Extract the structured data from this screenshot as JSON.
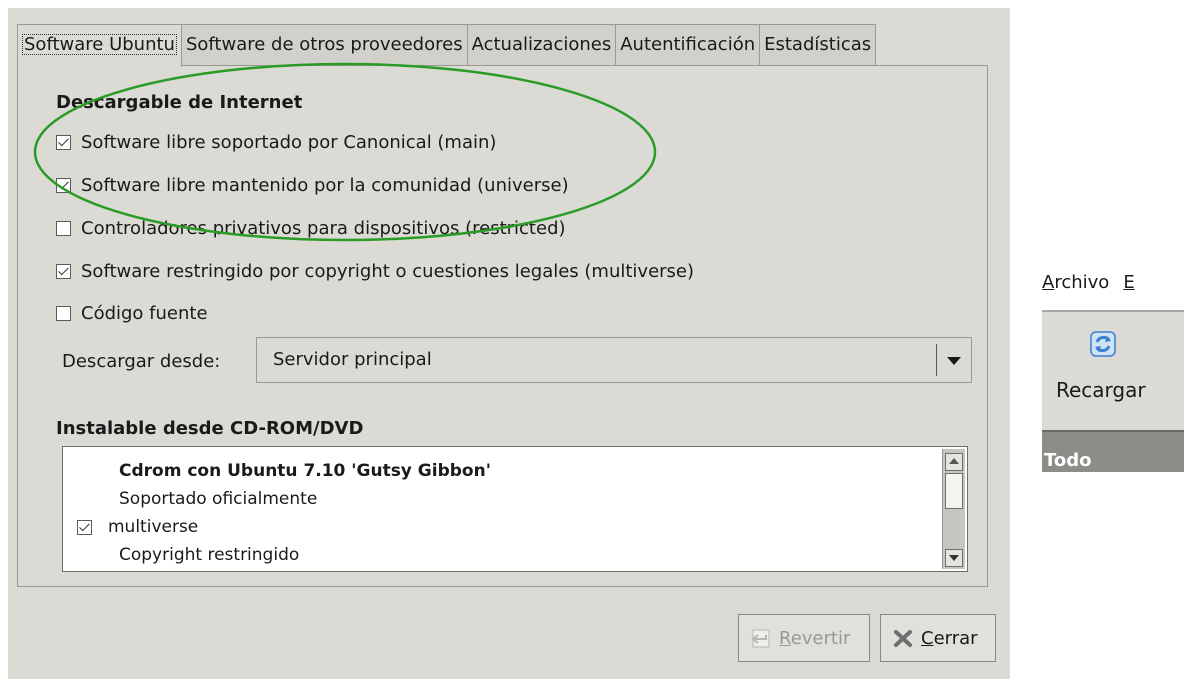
{
  "tabs": [
    "Software Ubuntu",
    "Software de otros proveedores",
    "Actualizaciones",
    "Autentificación",
    "Estadísticas"
  ],
  "internet_section": {
    "title": "Descargable de Internet",
    "options": [
      {
        "label": "Software libre soportado por Canonical (main)",
        "checked": true
      },
      {
        "label": "Software libre mantenido por la comunidad (universe)",
        "checked": true
      },
      {
        "label": "Controladores privativos para dispositivos (restricted)",
        "checked": false
      },
      {
        "label": "Software restringido por copyright o cuestiones legales (multiverse)",
        "checked": true
      },
      {
        "label": "Código fuente",
        "checked": false
      }
    ],
    "download_label": "Descargar desde:",
    "download_value": "Servidor principal"
  },
  "cdrom_section": {
    "title": "Instalable desde CD-ROM/DVD",
    "entry_title": "Cdrom con Ubuntu 7.10 'Gutsy Gibbon'",
    "entry_lines": [
      "Soportado oficialmente",
      "multiverse",
      "Copyright restringido"
    ],
    "entry_checked": true
  },
  "buttons": {
    "revert_label": "Revertir",
    "revert_mnemonic": "R",
    "revert_rest": "evertir",
    "close_label": "Cerrar",
    "close_mnemonic": "C",
    "close_rest": "errar"
  },
  "fragment": {
    "menu_file": "Archivo",
    "menu_file_mnemonic": "A",
    "menu_file_rest": "rchivo",
    "menu_edit_mnemonic": "E",
    "reload_label": "Recargar",
    "filter_label": "Todo"
  },
  "colors": {
    "annotation_ellipse": "#2a9b26",
    "reload_icon": "#3b7fd0"
  }
}
